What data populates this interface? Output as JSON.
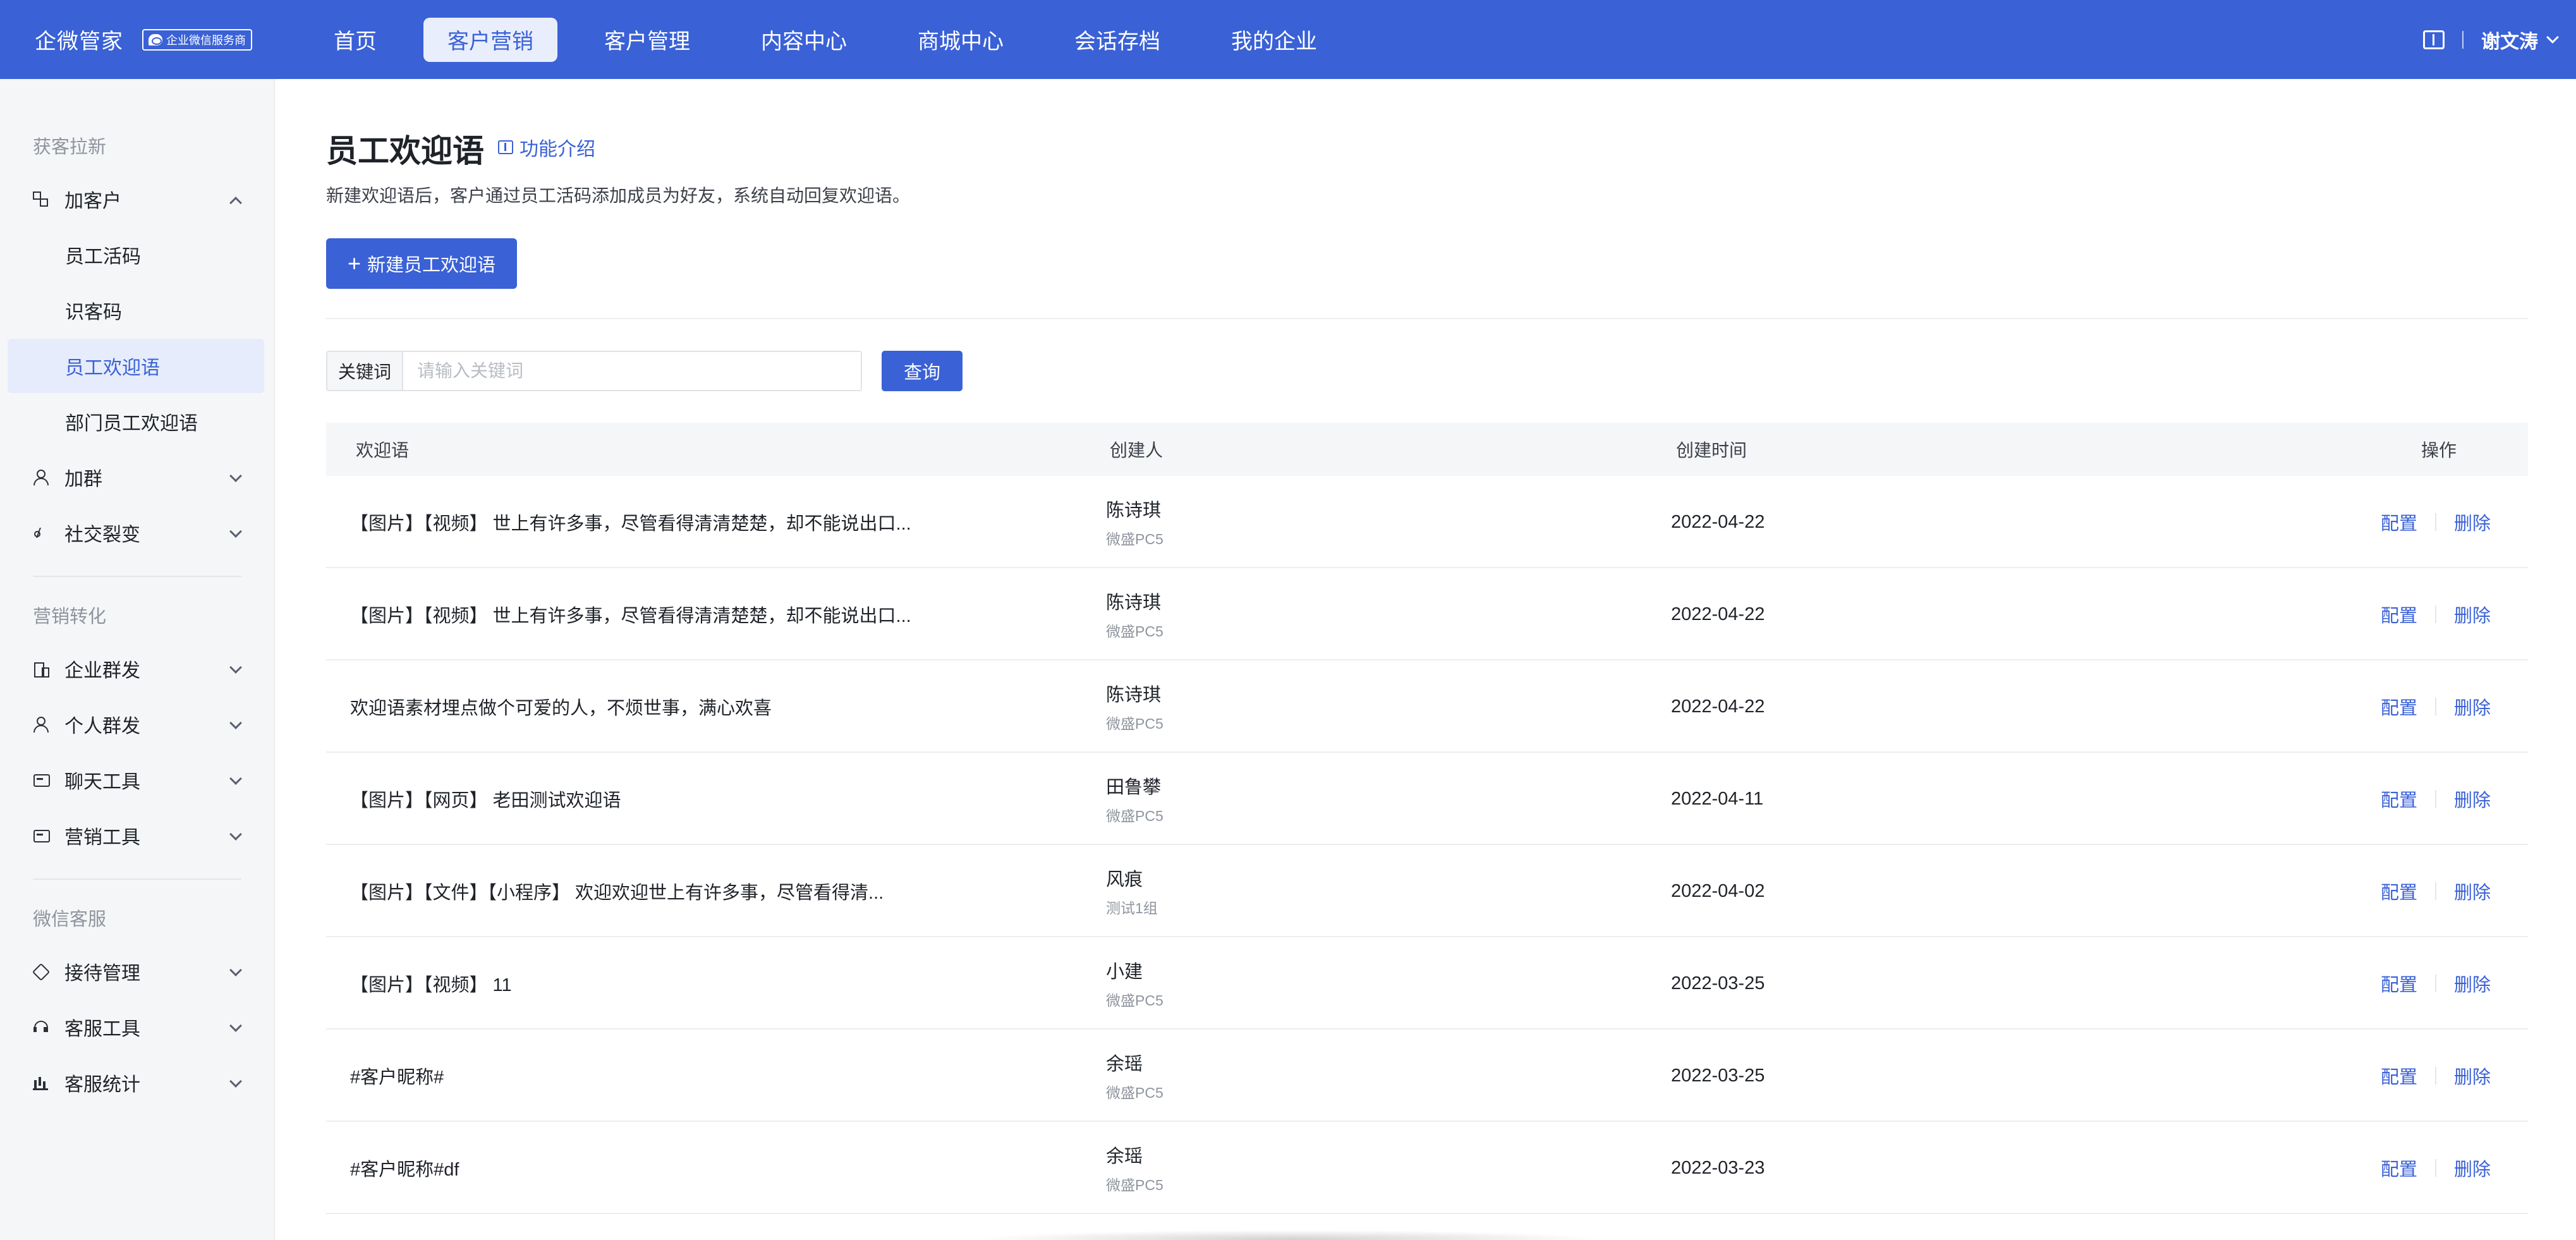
{
  "topbar": {
    "brand": "企微管家",
    "badge": "企业微信服务商",
    "nav": [
      "首页",
      "客户营销",
      "客户管理",
      "内容中心",
      "商城中心",
      "会话存档",
      "我的企业"
    ],
    "active_nav": "客户营销",
    "username": "谢文涛"
  },
  "sidebar": {
    "sections": [
      {
        "title": "获客拉新"
      },
      {
        "title": "营销转化"
      },
      {
        "title": "微信客服"
      }
    ],
    "items": [
      {
        "label": "加客户",
        "icon": "grid-icon"
      },
      {
        "label": "员工活码"
      },
      {
        "label": "识客码"
      },
      {
        "label": "员工欢迎语"
      },
      {
        "label": "部门员工欢迎语"
      },
      {
        "label": "加群",
        "icon": "person-icon"
      },
      {
        "label": "社交裂变",
        "icon": "share-icon"
      },
      {
        "label": "企业群发",
        "icon": "building-icon"
      },
      {
        "label": "个人群发",
        "icon": "person-icon"
      },
      {
        "label": "聊天工具",
        "icon": "chat-icon"
      },
      {
        "label": "营销工具",
        "icon": "chat-icon"
      },
      {
        "label": "接待管理",
        "icon": "tag-icon"
      },
      {
        "label": "客服工具",
        "icon": "headset-icon"
      },
      {
        "label": "客服统计",
        "icon": "bars-icon"
      }
    ],
    "active_item": "员工欢迎语"
  },
  "main": {
    "title": "员工欢迎语",
    "intro_link": "功能介绍",
    "description": "新建欢迎语后，客户通过员工活码添加成员为好友，系统自动回复欢迎语。",
    "new_button": "新建员工欢迎语",
    "search": {
      "label": "关键词",
      "placeholder": "请输入关键词",
      "value": "",
      "button": "查询"
    },
    "table": {
      "columns": [
        "欢迎语",
        "创建人",
        "创建时间",
        "操作"
      ],
      "rows": [
        {
          "greeting": "【图片】【视频】 世上有许多事，尽管看得清清楚楚，却不能说出口...",
          "creator": "陈诗琪",
          "dept": "微盛PC5",
          "time": "2022-04-22"
        },
        {
          "greeting": "【图片】【视频】 世上有许多事，尽管看得清清楚楚，却不能说出口...",
          "creator": "陈诗琪",
          "dept": "微盛PC5",
          "time": "2022-04-22"
        },
        {
          "greeting": "欢迎语素材埋点做个可爱的人，不烦世事，满心欢喜",
          "creator": "陈诗琪",
          "dept": "微盛PC5",
          "time": "2022-04-22"
        },
        {
          "greeting": "【图片】【网页】 老田测试欢迎语",
          "creator": "田鲁攀",
          "dept": "微盛PC5",
          "time": "2022-04-11"
        },
        {
          "greeting": "【图片】【文件】【小程序】 欢迎欢迎世上有许多事，尽管看得清...",
          "creator": "风痕",
          "dept": "测试1组",
          "time": "2022-04-02"
        },
        {
          "greeting": "【图片】【视频】 11",
          "creator": "小建",
          "dept": "微盛PC5",
          "time": "2022-03-25"
        },
        {
          "greeting": "#客户昵称#",
          "creator": "余瑶",
          "dept": "微盛PC5",
          "time": "2022-03-25"
        },
        {
          "greeting": "#客户昵称#df",
          "creator": "余瑶",
          "dept": "微盛PC5",
          "time": "2022-03-23"
        }
      ],
      "actions": {
        "config": "配置",
        "delete": "删除"
      }
    }
  },
  "colors": {
    "brand": "#3a61d6",
    "sidebar_bg": "#f5f6f8",
    "active_bg": "#e6ecfb"
  }
}
